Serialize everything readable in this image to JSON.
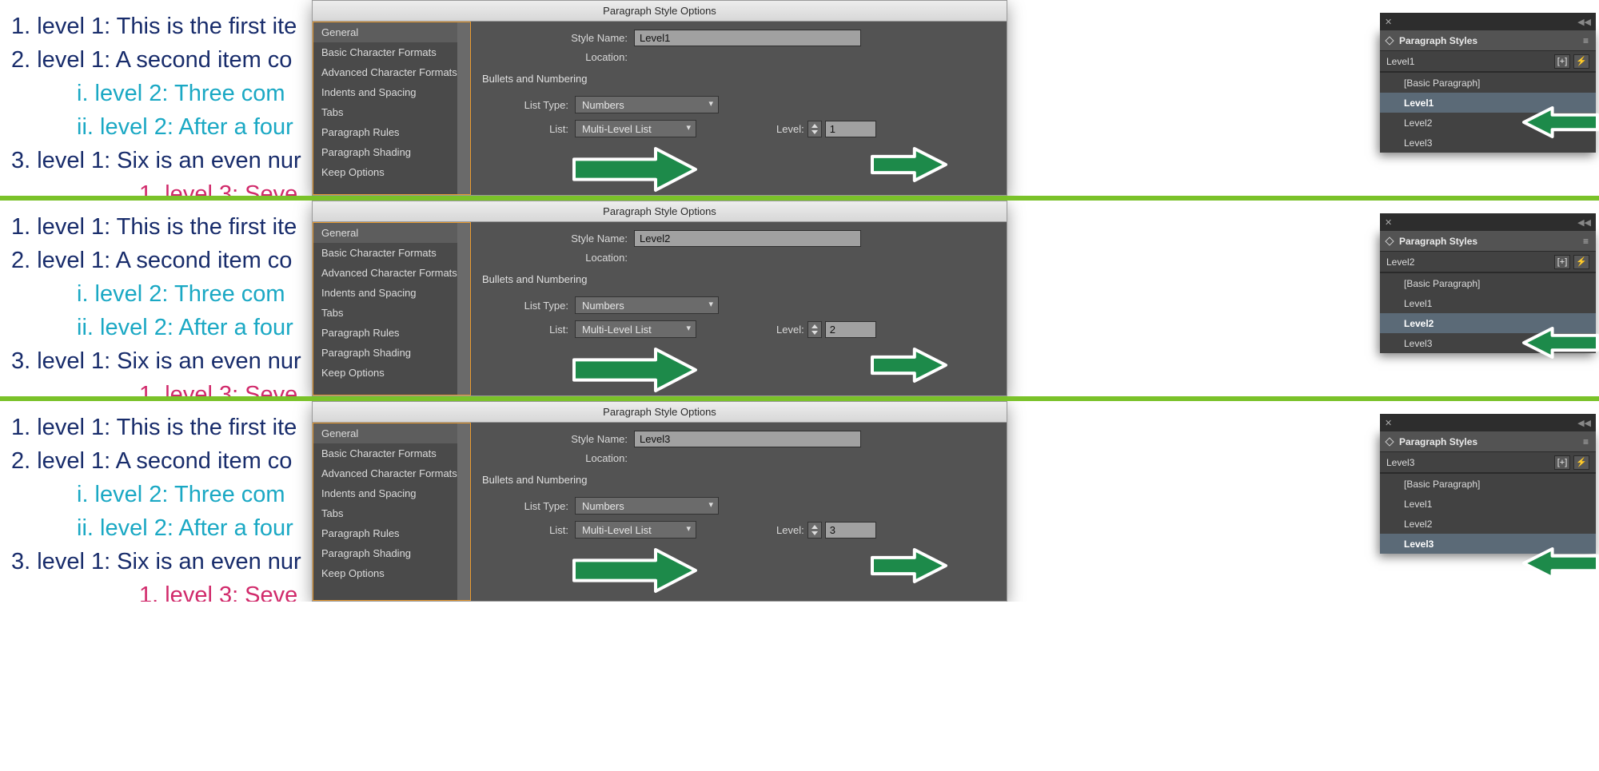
{
  "examples": [
    {
      "styleName": "Level1",
      "levelValue": "1",
      "currentStyle": "Level1",
      "highlight": "Level1"
    },
    {
      "styleName": "Level2",
      "levelValue": "2",
      "currentStyle": "Level2",
      "highlight": "Level2"
    },
    {
      "styleName": "Level3",
      "levelValue": "3",
      "currentStyle": "Level3",
      "highlight": "Level3"
    }
  ],
  "doc": {
    "l1a": "1.  level 1: This is the first ite",
    "l1b": "2. level 1: A second item co",
    "l2a": "i.  level 2: Three com",
    "l2b": "ii. level 2: After a four",
    "l1c": "3. level 1: Six is an even nur",
    "l3a": "1.  level 3: Seve"
  },
  "dialog": {
    "title": "Paragraph Style Options",
    "sidebar": [
      "General",
      "Basic Character Formats",
      "Advanced Character Formats",
      "Indents and Spacing",
      "Tabs",
      "Paragraph Rules",
      "Paragraph Shading",
      "Keep Options"
    ],
    "labels": {
      "styleName": "Style Name:",
      "location": "Location:",
      "section": "Bullets and Numbering",
      "listType": "List Type:",
      "listTypeValue": "Numbers",
      "list": "List:",
      "listValue": "Multi-Level List",
      "level": "Level:"
    }
  },
  "panel": {
    "title": "Paragraph Styles",
    "items": [
      "[Basic Paragraph]",
      "Level1",
      "Level2",
      "Level3"
    ]
  }
}
